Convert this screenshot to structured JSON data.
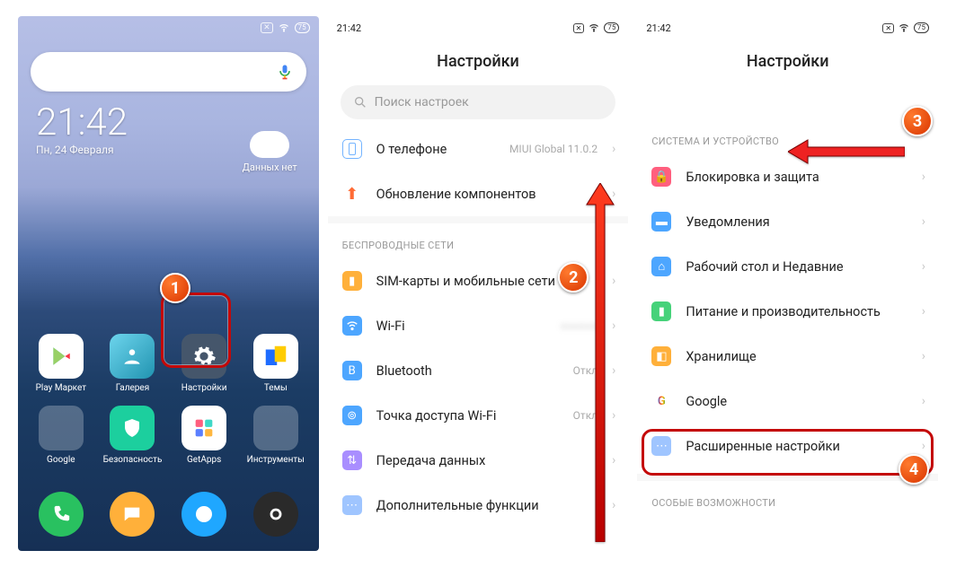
{
  "annotations": {
    "step1": "1",
    "step2": "2",
    "step3": "3",
    "step4": "4"
  },
  "home": {
    "battery": "75",
    "clock": "21:42",
    "date": "Пн, 24 Февраля",
    "weather": "Данных нет",
    "apps_row1": {
      "play": "Play Маркет",
      "gallery": "Галерея",
      "settings": "Настройки",
      "themes": "Темы"
    },
    "apps_row2": {
      "google": "Google",
      "security": "Безопасность",
      "getapps": "GetApps",
      "tools": "Инструменты"
    }
  },
  "settings1": {
    "time": "21:42",
    "battery": "75",
    "title": "Настройки",
    "search_placeholder": "Поиск настроек",
    "about": "О телефоне",
    "about_sub": "MIUI Global 11.0.2",
    "updates": "Обновление компонентов",
    "section_wireless": "БЕСПРОВОДНЫЕ СЕТИ",
    "sim": "SIM-карты и мобильные сети",
    "wifi": "Wi-Fi",
    "bt": "Bluetooth",
    "bt_sub": "Откл",
    "hotspot": "Точка доступа Wi-Fi",
    "hotspot_sub": "Откл",
    "data": "Передача данных",
    "more": "Дополнительные функции"
  },
  "settings2": {
    "time": "21:42",
    "battery": "75",
    "title": "Настройки",
    "section_system": "СИСТЕМА И УСТРОЙСТВО",
    "lock": "Блокировка и защита",
    "notif": "Уведомления",
    "desktop": "Рабочий стол и Недавние",
    "power": "Питание и производительность",
    "storage": "Хранилище",
    "google": "Google",
    "advanced": "Расширенные настройки",
    "section_special": "ОСОБЫЕ ВОЗМОЖНОСТИ"
  }
}
